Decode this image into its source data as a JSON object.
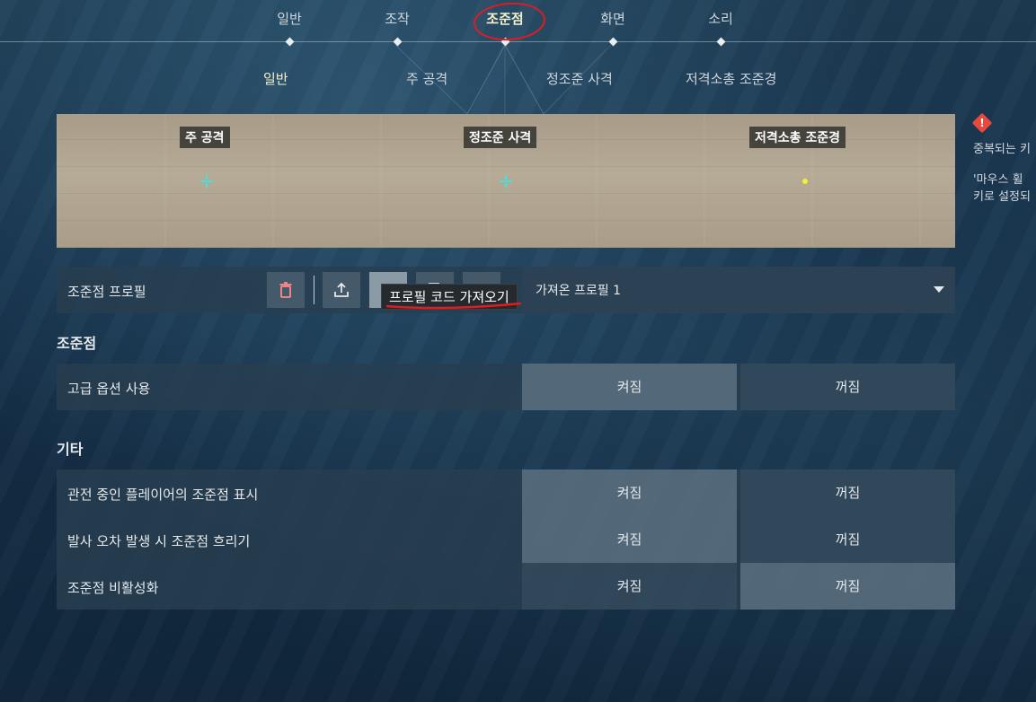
{
  "top_tabs": [
    {
      "label": "일반",
      "active": false
    },
    {
      "label": "조작",
      "active": false
    },
    {
      "label": "조준점",
      "active": true
    },
    {
      "label": "화면",
      "active": false
    },
    {
      "label": "소리",
      "active": false
    }
  ],
  "sub_tabs": [
    {
      "label": "일반",
      "active": true
    },
    {
      "label": "주 공격",
      "active": false
    },
    {
      "label": "정조준 사격",
      "active": false
    },
    {
      "label": "저격소총 조준경",
      "active": false
    }
  ],
  "preview": {
    "labels": [
      "주 공격",
      "정조준 사격",
      "저격소총 조준경"
    ]
  },
  "warning": {
    "icon": "warning-icon",
    "lines": [
      "중복되는 키",
      "'마우스 휠 ",
      "키로 설정되"
    ]
  },
  "profile": {
    "label": "조준점 프로필",
    "tooltip": "프로필 코드 가져오기",
    "selected": "가져온 프로필 1",
    "buttons": [
      "trash-icon",
      "upload-icon",
      "import-icon",
      "copy-icon",
      "add-icon"
    ]
  },
  "sections": {
    "crosshair": {
      "title": "조준점",
      "rows": [
        {
          "label": "고급 옵션 사용",
          "on": "켜짐",
          "off": "꺼짐",
          "selected": "on"
        }
      ]
    },
    "other": {
      "title": "기타",
      "rows": [
        {
          "label": "관전 중인 플레이어의 조준점 표시",
          "on": "켜짐",
          "off": "꺼짐",
          "selected": "on"
        },
        {
          "label": "발사 오차 발생 시 조준점 흐리기",
          "on": "켜짐",
          "off": "꺼짐",
          "selected": "on"
        },
        {
          "label": "조준점 비활성화",
          "on": "켜짐",
          "off": "꺼짐",
          "selected": "off"
        }
      ]
    }
  },
  "colors": {
    "accent_active_text": "#f3f0c8",
    "annotation_red": "#e01b22",
    "crosshair_cyan": "#3fe3e0",
    "sniper_dot_yellow": "#f6f02a"
  }
}
